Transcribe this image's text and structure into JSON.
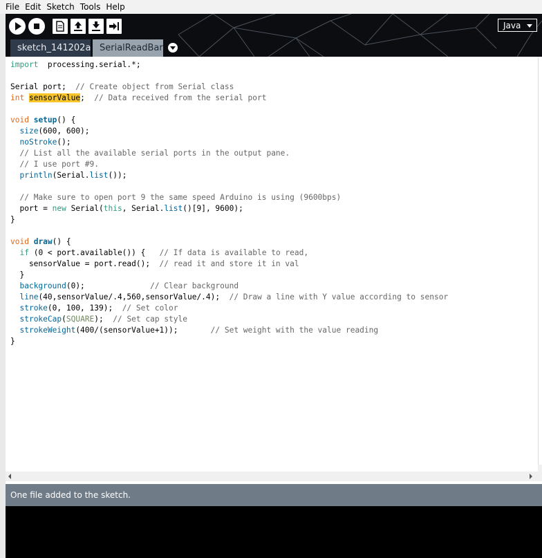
{
  "menu": [
    "File",
    "Edit",
    "Sketch",
    "Tools",
    "Help"
  ],
  "toolbar": {
    "buttons": [
      {
        "name": "run-button",
        "icon": "play-icon"
      },
      {
        "name": "stop-button",
        "icon": "stop-icon"
      },
      {
        "name": "new-button",
        "icon": "new-file-icon"
      },
      {
        "name": "open-button",
        "icon": "open-icon"
      },
      {
        "name": "save-button",
        "icon": "save-icon"
      },
      {
        "name": "export-button",
        "icon": "export-icon"
      }
    ],
    "mode": "Java"
  },
  "tabs": [
    {
      "label": "sketch_141202a",
      "active": false
    },
    {
      "label": "SerialReadBar",
      "active": true
    }
  ],
  "code_lines": [
    [
      [
        "kw",
        "import"
      ],
      [
        "",
        "  processing.serial.*;"
      ]
    ],
    [],
    [
      [
        "",
        "Serial port;  "
      ],
      [
        "cm",
        "// Create object from Serial class"
      ]
    ],
    [
      [
        "type",
        "int"
      ],
      [
        "",
        " "
      ],
      [
        "hl",
        "sensorValue"
      ],
      [
        "",
        ";  "
      ],
      [
        "cm",
        "// Data received from the serial port"
      ]
    ],
    [],
    [
      [
        "type",
        "void"
      ],
      [
        "",
        " "
      ],
      [
        "fnb",
        "setup"
      ],
      [
        "",
        "() {"
      ]
    ],
    [
      [
        "",
        "  "
      ],
      [
        "fn",
        "size"
      ],
      [
        "",
        "(600, 600);"
      ]
    ],
    [
      [
        "",
        "  "
      ],
      [
        "fn",
        "noStroke"
      ],
      [
        "",
        "();"
      ]
    ],
    [
      [
        "",
        "  "
      ],
      [
        "cm",
        "// List all the available serial ports in the output pane."
      ]
    ],
    [
      [
        "",
        "  "
      ],
      [
        "cm",
        "// I use port #9."
      ]
    ],
    [
      [
        "",
        "  "
      ],
      [
        "fn",
        "println"
      ],
      [
        "",
        "(Serial."
      ],
      [
        "fn",
        "list"
      ],
      [
        "",
        "());"
      ]
    ],
    [],
    [
      [
        "",
        "  "
      ],
      [
        "cm",
        "// Make sure to open port 9 the same speed Arduino is using (9600bps)"
      ]
    ],
    [
      [
        "",
        "  port = "
      ],
      [
        "kw",
        "new"
      ],
      [
        "",
        " Serial("
      ],
      [
        "kw",
        "this"
      ],
      [
        "",
        ", Serial."
      ],
      [
        "fn",
        "list"
      ],
      [
        "",
        "()[9], 9600);"
      ]
    ],
    [
      [
        "",
        "}"
      ]
    ],
    [],
    [
      [
        "type",
        "void"
      ],
      [
        "",
        " "
      ],
      [
        "fnb",
        "draw"
      ],
      [
        "",
        "() {"
      ]
    ],
    [
      [
        "",
        "  "
      ],
      [
        "kw",
        "if"
      ],
      [
        "",
        " (0 < port.available()) {   "
      ],
      [
        "cm",
        "// If data is available to read,"
      ]
    ],
    [
      [
        "",
        "    sensorValue = port.read();  "
      ],
      [
        "cm",
        "// read it and store it in val"
      ]
    ],
    [
      [
        "",
        "  }"
      ]
    ],
    [
      [
        "",
        "  "
      ],
      [
        "fn",
        "background"
      ],
      [
        "",
        "(0);              "
      ],
      [
        "cm",
        "// Clear background"
      ]
    ],
    [
      [
        "",
        "  "
      ],
      [
        "fn",
        "line"
      ],
      [
        "",
        "(40,sensorValue/.4,560,sensorValue/.4);  "
      ],
      [
        "cm",
        "// Draw a line with Y value according to sensor"
      ]
    ],
    [
      [
        "",
        "  "
      ],
      [
        "fn",
        "stroke"
      ],
      [
        "",
        "(0, 100, 139);  "
      ],
      [
        "cm",
        "// Set color"
      ]
    ],
    [
      [
        "",
        "  "
      ],
      [
        "fn",
        "strokeCap"
      ],
      [
        "",
        "("
      ],
      [
        "lit",
        "SQUARE"
      ],
      [
        "",
        "); "
      ],
      [
        "cm",
        " // Set cap style"
      ]
    ],
    [
      [
        "",
        "  "
      ],
      [
        "fn",
        "strokeWeight"
      ],
      [
        "",
        "(400/(sensorValue+1));       "
      ],
      [
        "cm",
        "// Set weight with the value reading"
      ]
    ],
    [
      [
        "",
        "}"
      ]
    ]
  ],
  "status_message": "One file added to the sketch.",
  "colors": {
    "toolbar_bg": "#0b0d10",
    "tab_inactive": "#2f3b4a",
    "tab_active": "#9aa4ae",
    "status_bg": "#6f7b87",
    "highlight": "#f7c42a",
    "keyword": "#33997e",
    "type": "#e2661a",
    "function": "#006699",
    "comment": "#666666"
  }
}
